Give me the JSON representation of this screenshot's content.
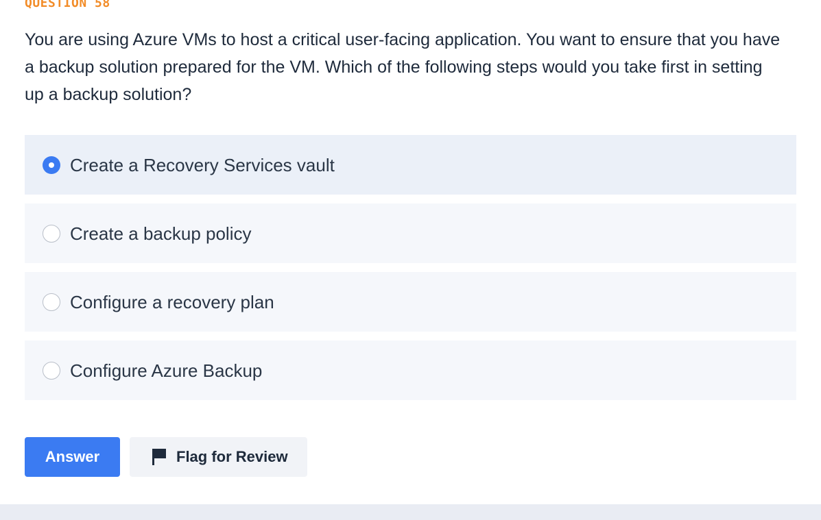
{
  "question": {
    "number_label": "QUESTION 58",
    "text": "You are using Azure VMs to host a critical user-facing application. You want to ensure that you have a backup solution prepared for the VM. Which of the following steps would you take first in setting up a backup solution?"
  },
  "options": [
    {
      "label": "Create a Recovery Services vault",
      "selected": true
    },
    {
      "label": "Create a backup policy",
      "selected": false
    },
    {
      "label": "Configure a recovery plan",
      "selected": false
    },
    {
      "label": "Configure Azure Backup",
      "selected": false
    }
  ],
  "actions": {
    "answer_label": "Answer",
    "flag_label": "Flag for Review",
    "flag_icon": "flag-icon"
  },
  "colors": {
    "accent": "#3b7bf2",
    "question_number": "#f28c28",
    "text": "#1e2a3b"
  }
}
